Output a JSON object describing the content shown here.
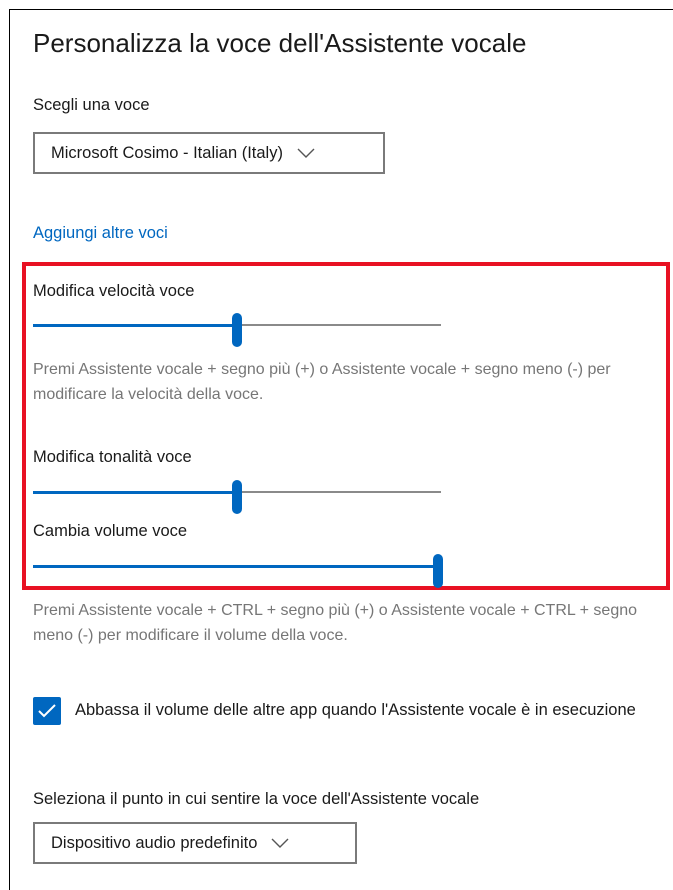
{
  "page": {
    "title": "Personalizza la voce dell'Assistente vocale"
  },
  "voice": {
    "label": "Scegli una voce",
    "selected": "Microsoft Cosimo - Italian (Italy)",
    "add_more_link": "Aggiungi altre voci"
  },
  "speed": {
    "label": "Modifica velocità voce",
    "value_fraction": 0.5,
    "help": "Premi Assistente vocale + segno più (+) o Assistente vocale + segno meno (-) per modificare la velocità della voce."
  },
  "pitch": {
    "label": "Modifica tonalità voce",
    "value_fraction": 0.5
  },
  "volume": {
    "label": "Cambia volume voce",
    "value_fraction": 1.0,
    "help": "Premi Assistente vocale + CTRL + segno più (+) o Assistente vocale + CTRL + segno meno (-) per modificare il volume della voce."
  },
  "lower_volume": {
    "checked": true,
    "label": "Abbassa il volume delle altre app quando l'Assistente vocale è in esecuzione"
  },
  "output": {
    "label": "Seleziona il punto in cui sentire la voce dell'Assistente vocale",
    "selected": "Dispositivo audio predefinito"
  },
  "colors": {
    "accent": "#0067c0",
    "highlight_border": "#e81123"
  }
}
